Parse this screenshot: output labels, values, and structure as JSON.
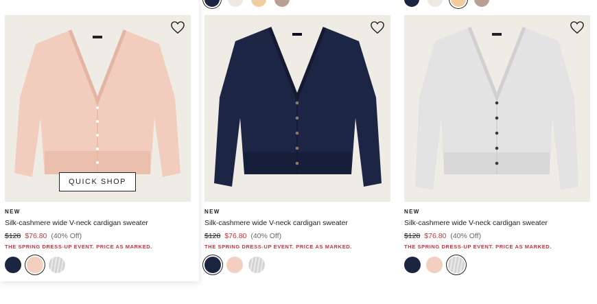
{
  "products": [
    {
      "badge": "NEW",
      "name": "Silk-cashmere wide V-neck cardigan sweater",
      "original_price": "$128",
      "sale_price": "$76.80",
      "discount": "(40% Off)",
      "promo": "THE SPRING DRESS-UP EVENT. PRICE AS MARKED.",
      "quick_shop": "QUICK SHOP",
      "color": "pink",
      "selected_swatch": "pink"
    },
    {
      "badge": "NEW",
      "name": "Silk-cashmere wide V-neck cardigan sweater",
      "original_price": "$128",
      "sale_price": "$76.80",
      "discount": "(40% Off)",
      "promo": "THE SPRING DRESS-UP EVENT. PRICE AS MARKED.",
      "color": "navy",
      "selected_swatch": "navy"
    },
    {
      "badge": "NEW",
      "name": "Silk-cashmere wide V-neck cardigan sweater",
      "original_price": "$128",
      "sale_price": "$76.80",
      "discount": "(40% Off)",
      "promo": "THE SPRING DRESS-UP EVENT. PRICE AS MARKED.",
      "color": "light-gray",
      "selected_swatch": "light-gray"
    }
  ],
  "swatch_colors": {
    "navy": "#1b2440",
    "pink": "#f2cfbf",
    "light-gray": "#d8d8d8",
    "cream": "#ece9e2",
    "peach": "#f1cc9f",
    "taupe": "#b9a095"
  },
  "colors": {
    "sale_red": "#c8323b",
    "image_bg": "#efebe5"
  },
  "icons": {
    "favorite": "heart-outline-icon"
  }
}
